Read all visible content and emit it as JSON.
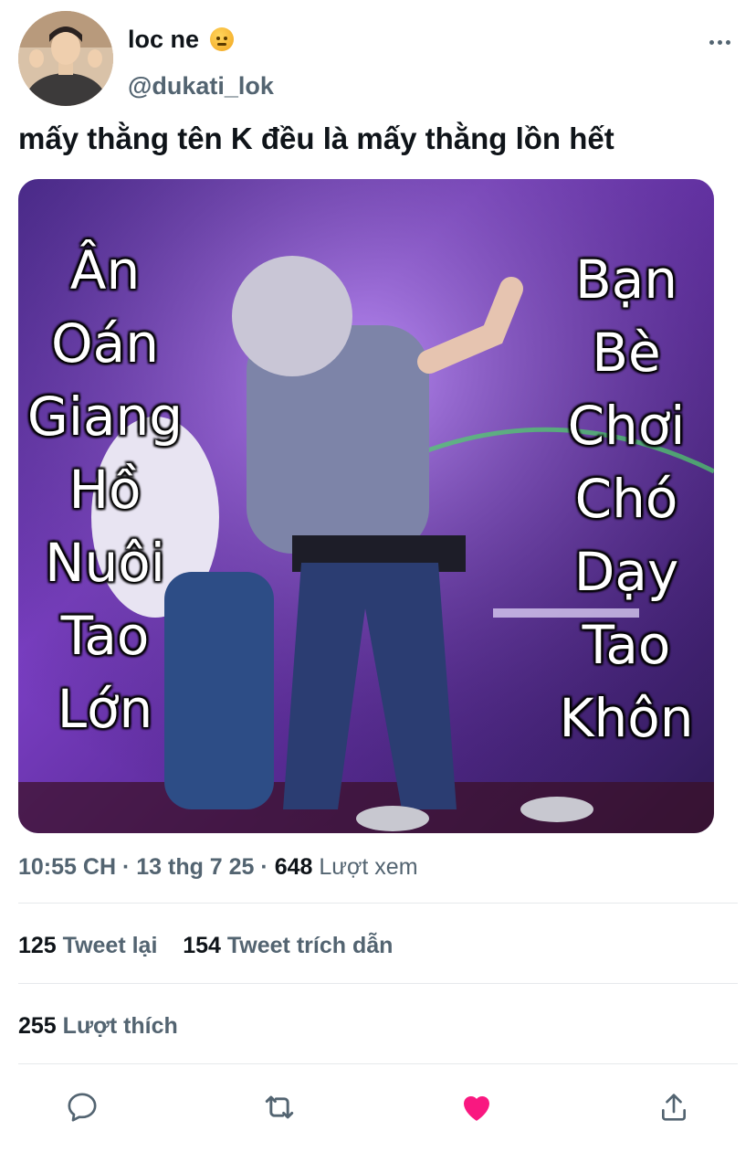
{
  "author": {
    "display_name": "loc ne",
    "handle": "@dukati_lok",
    "status_emoji": "angry-face-emoji"
  },
  "tweet": {
    "text": "mấy thằng tên K đều là mấy thằng lồn hết"
  },
  "media": {
    "left_caption": [
      "Ân",
      "Oán",
      "Giang",
      "Hồ",
      "Nuôi",
      "Tao",
      "Lớn"
    ],
    "right_caption": [
      "Bạn",
      "Bè",
      "Chơi",
      "Chó",
      "Dạy",
      "Tao",
      "Khôn"
    ]
  },
  "meta": {
    "time": "10:55 CH",
    "separator": "·",
    "date": "13 thg 7 25",
    "views_count": "648",
    "views_label": "Lượt xem"
  },
  "stats": {
    "retweets_count": "125",
    "retweets_label": "Tweet lại",
    "quotes_count": "154",
    "quotes_label": "Tweet trích dẫn",
    "likes_count": "255",
    "likes_label": "Lượt thích"
  },
  "actions": [
    {
      "name": "reply",
      "icon": "speech-bubble-icon"
    },
    {
      "name": "retweet",
      "icon": "retweet-arrows-icon"
    },
    {
      "name": "like",
      "icon": "heart-icon",
      "active": true
    },
    {
      "name": "share",
      "icon": "share-upload-icon"
    }
  ],
  "colors": {
    "text_primary": "#0f1419",
    "text_secondary": "#536471",
    "like_active": "#f91880",
    "divider": "#e6e9ec"
  }
}
